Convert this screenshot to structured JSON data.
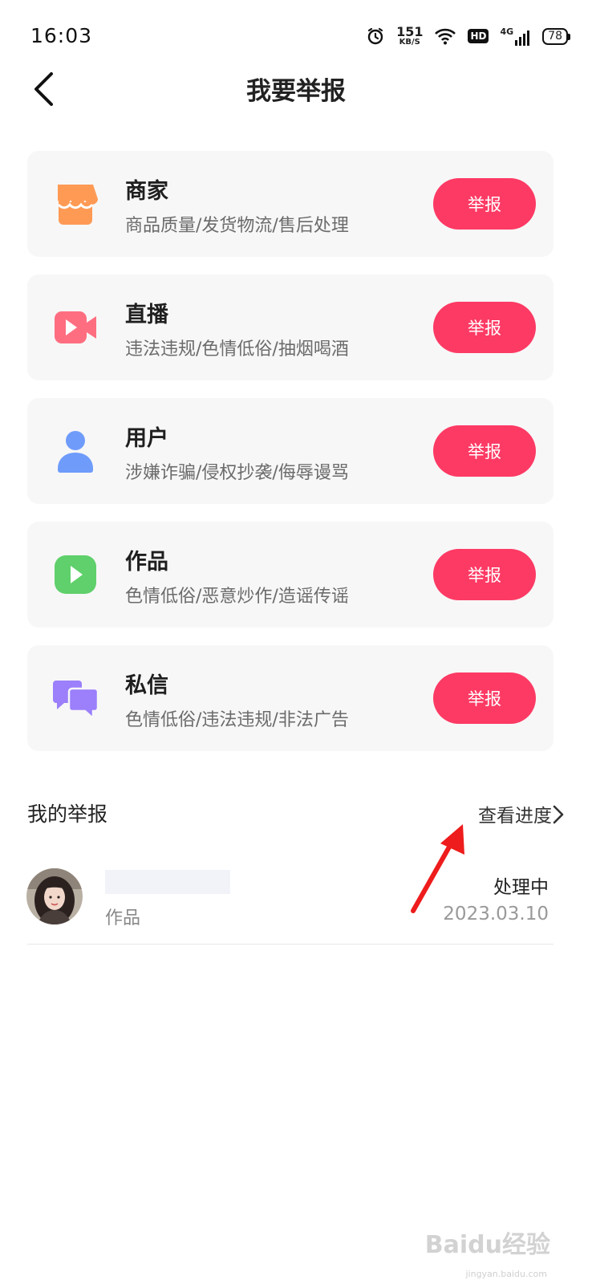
{
  "status_bar": {
    "time": "16:03",
    "net_speed": "151",
    "net_unit": "KB/S",
    "hd": "HD",
    "signal": "4G",
    "battery": "78"
  },
  "header": {
    "title": "我要举报"
  },
  "categories": [
    {
      "name": "商家",
      "desc": "商品质量/发货物流/售后处理",
      "button": "举报",
      "icon": "shop-icon",
      "color": "#ff9a55"
    },
    {
      "name": "直播",
      "desc": "违法违规/色情低俗/抽烟喝酒",
      "button": "举报",
      "icon": "live-video-icon",
      "color": "#fe6e80"
    },
    {
      "name": "用户",
      "desc": "涉嫌诈骗/侵权抄袭/侮辱谩骂",
      "button": "举报",
      "icon": "user-icon",
      "color": "#6f9cfb"
    },
    {
      "name": "作品",
      "desc": "色情低俗/恶意炒作/造谣传谣",
      "button": "举报",
      "icon": "play-icon",
      "color": "#5fd06b"
    },
    {
      "name": "私信",
      "desc": "色情低俗/违法违规/非法广告",
      "button": "举报",
      "icon": "chat-icon",
      "color": "#9b7ffb"
    }
  ],
  "my_reports": {
    "title": "我的举报",
    "view_progress": "查看进度",
    "items": [
      {
        "type": "作品",
        "status": "处理中",
        "date": "2023.03.10"
      }
    ]
  },
  "watermark": {
    "brand": "Baidu经验",
    "url": "jingyan.baidu.com"
  },
  "colors": {
    "accent": "#fd3a64",
    "card_bg": "#f7f7f7",
    "annotation_arrow": "#ee1c1c"
  }
}
